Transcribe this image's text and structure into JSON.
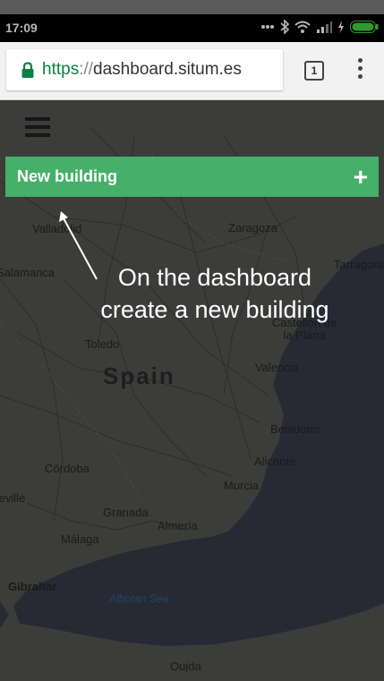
{
  "status_bar": {
    "time": "17:09",
    "icons": [
      "more-dots-icon",
      "bluetooth-icon",
      "wifi-icon",
      "signal-icon",
      "charging-icon",
      "battery-icon"
    ]
  },
  "browser": {
    "url_scheme": "https",
    "url_separator": "://",
    "url_host": "dashboard.situm.es",
    "tab_count": "1",
    "secure_color": "#0b8043"
  },
  "app": {
    "new_building_label": "New building",
    "add_symbol": "+",
    "accent_color": "#46b06a"
  },
  "annotation": {
    "line1": "On the dashboard",
    "line2": "create a new building"
  },
  "map_labels": {
    "valladolid": "Valladolid",
    "zaragoza": "Zaragoza",
    "salamanca": "Salamanca",
    "tarragona": "Tarragona",
    "toledo": "Toledo",
    "castellon": "Castellón de la Plana",
    "spain": "Spain",
    "valencia": "Valencia",
    "benidorm": "Benidorm",
    "alicante": "Alicante",
    "cordoba": "Córdoba",
    "murcia": "Murcia",
    "seville": "Seville",
    "granada": "Granada",
    "almeria": "Almería",
    "malaga": "Málaga",
    "gibraltar": "Gibraltar",
    "alboran_sea": "Alboran Sea",
    "oujda": "Oujda"
  }
}
